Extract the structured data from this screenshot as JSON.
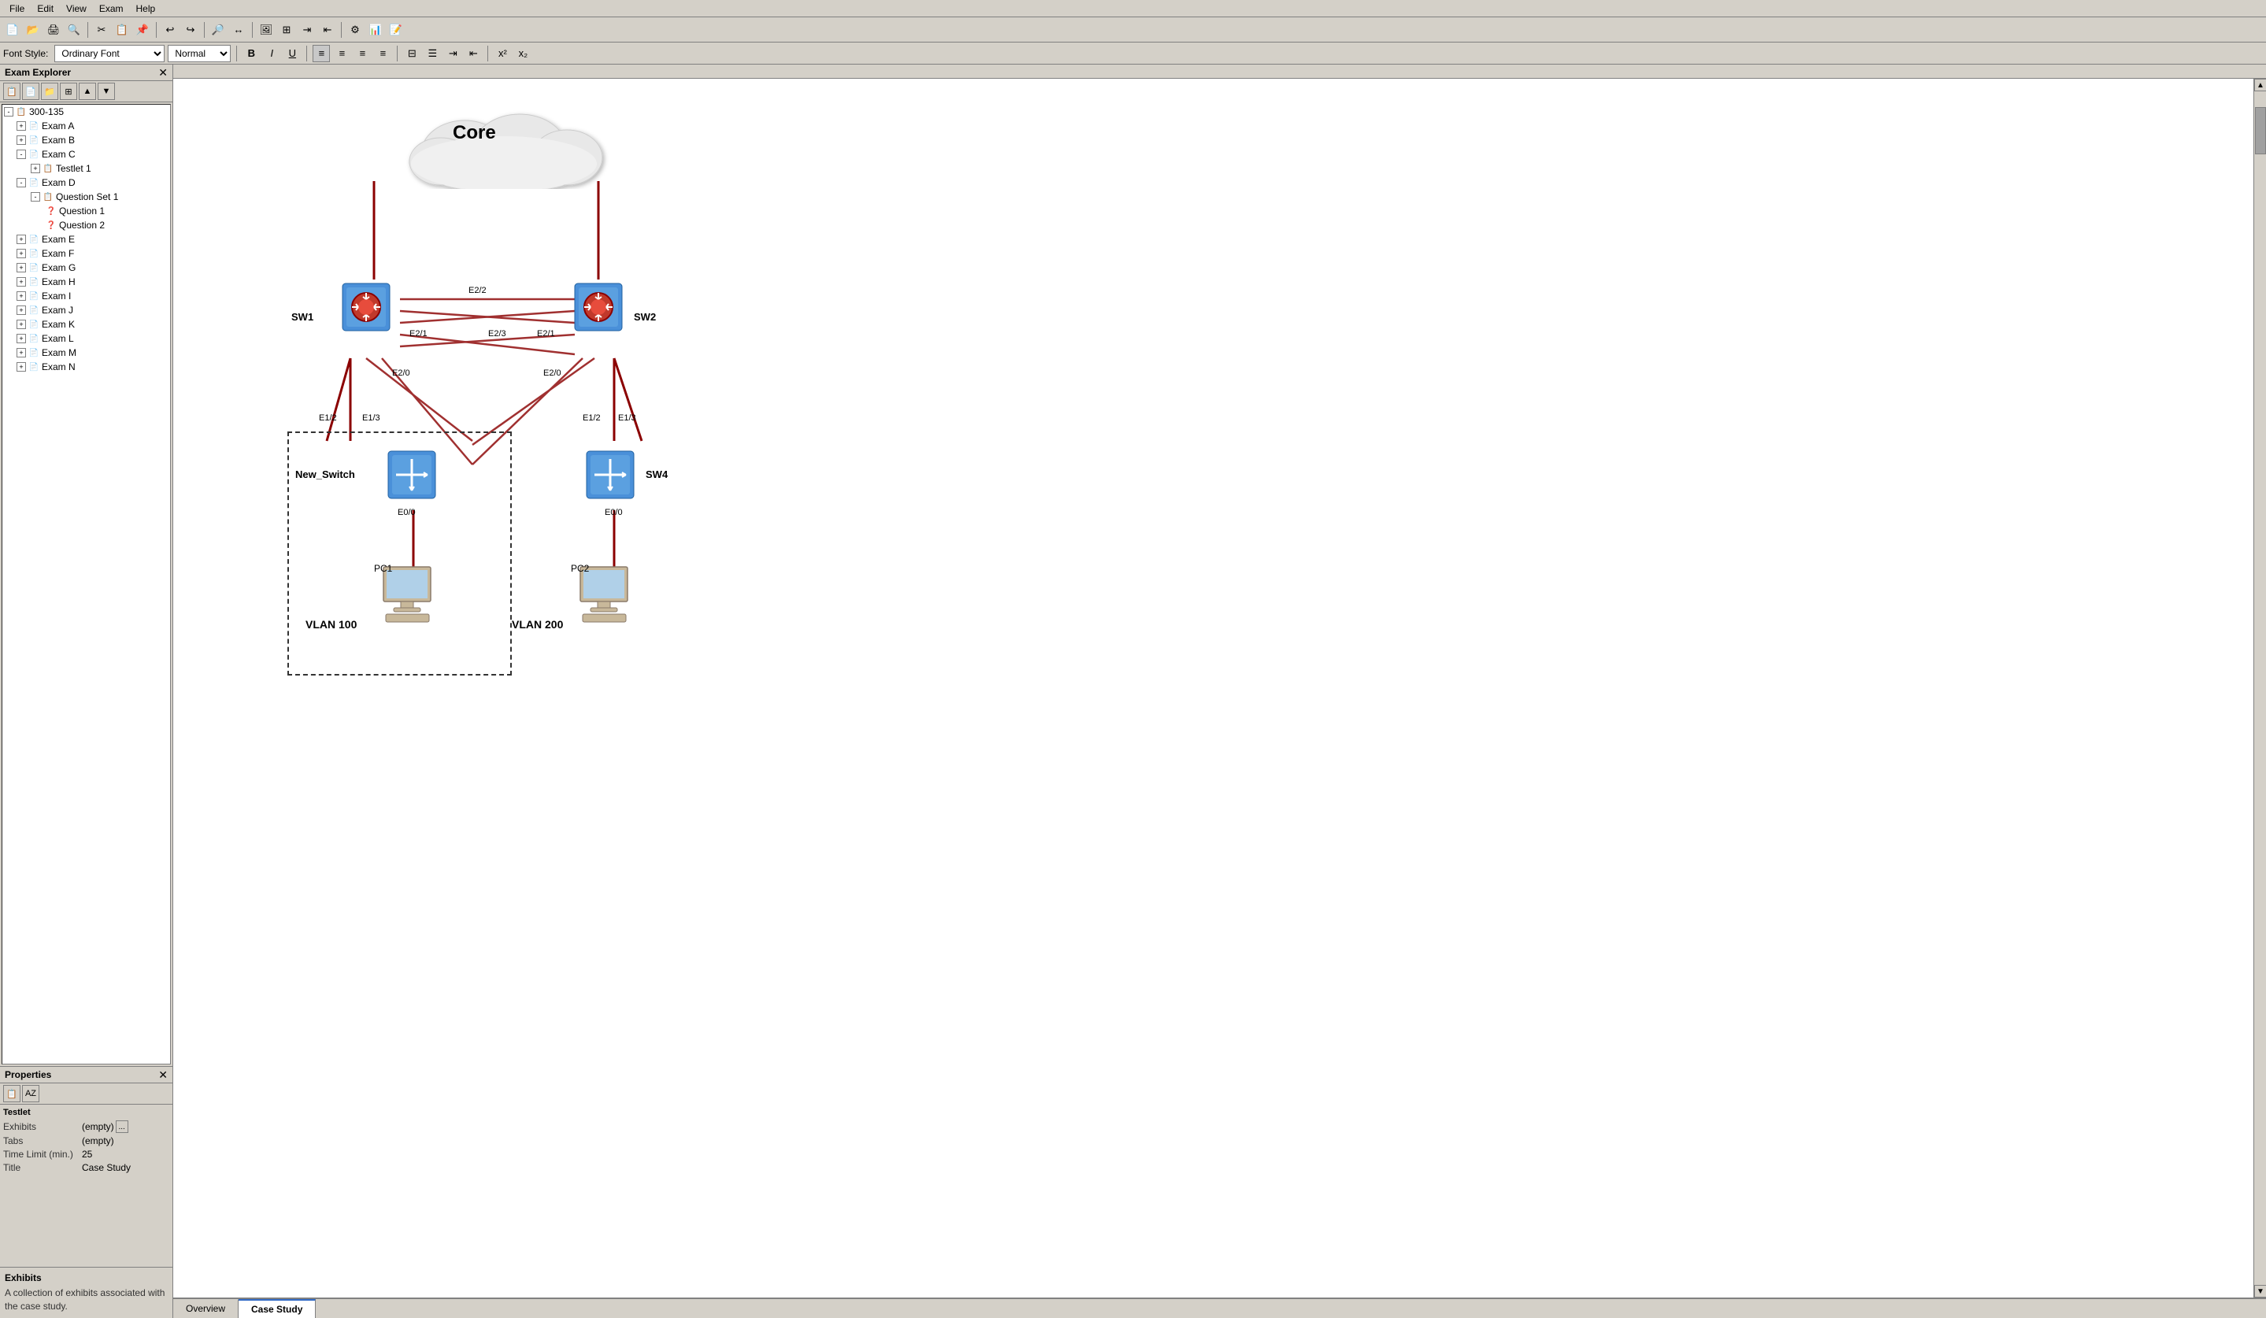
{
  "app": {
    "menu": [
      "File",
      "Edit",
      "View",
      "Exam",
      "Help"
    ],
    "font_style_label": "Font Style:",
    "font_name": "Ordinary Font",
    "font_size": "Normal",
    "bold": "B",
    "italic": "I",
    "underline": "U"
  },
  "explorer": {
    "title": "Exam Explorer",
    "root": "300-135",
    "items": [
      {
        "id": "exam-a",
        "label": "Exam A",
        "level": 1,
        "expanded": false
      },
      {
        "id": "exam-b",
        "label": "Exam B",
        "level": 1,
        "expanded": false
      },
      {
        "id": "exam-c",
        "label": "Exam C",
        "level": 1,
        "expanded": true
      },
      {
        "id": "testlet-1",
        "label": "Testlet 1",
        "level": 2,
        "expanded": false
      },
      {
        "id": "exam-d",
        "label": "Exam D",
        "level": 1,
        "expanded": true
      },
      {
        "id": "question-set-1",
        "label": "Question Set 1",
        "level": 2,
        "expanded": true
      },
      {
        "id": "question-1",
        "label": "Question 1",
        "level": 3,
        "expanded": false
      },
      {
        "id": "question-2",
        "label": "Question 2",
        "level": 3,
        "expanded": false
      },
      {
        "id": "exam-e",
        "label": "Exam E",
        "level": 1,
        "expanded": false
      },
      {
        "id": "exam-f",
        "label": "Exam F",
        "level": 1,
        "expanded": false
      },
      {
        "id": "exam-g",
        "label": "Exam G",
        "level": 1,
        "expanded": false
      },
      {
        "id": "exam-h",
        "label": "Exam H",
        "level": 1,
        "expanded": false
      },
      {
        "id": "exam-i",
        "label": "Exam I",
        "level": 1,
        "expanded": false
      },
      {
        "id": "exam-j",
        "label": "Exam J",
        "level": 1,
        "expanded": false
      },
      {
        "id": "exam-k",
        "label": "Exam K",
        "level": 1,
        "expanded": false
      },
      {
        "id": "exam-l",
        "label": "Exam L",
        "level": 1,
        "expanded": false
      },
      {
        "id": "exam-m",
        "label": "Exam M",
        "level": 1,
        "expanded": false
      },
      {
        "id": "exam-n",
        "label": "Exam N",
        "level": 1,
        "expanded": false
      }
    ]
  },
  "properties": {
    "title": "Properties",
    "section": "Testlet",
    "fields": [
      {
        "label": "Exhibits",
        "value": "(empty)",
        "has_btn": true
      },
      {
        "label": "Tabs",
        "value": "(empty)",
        "has_btn": false
      },
      {
        "label": "Time Limit (min.)",
        "value": "25",
        "has_btn": false
      },
      {
        "label": "Title",
        "value": "Case Study",
        "has_btn": false
      }
    ]
  },
  "bottom_desc": {
    "title": "Exhibits",
    "text": "A collection of exhibits associated with the case study."
  },
  "tabs": [
    {
      "label": "Overview",
      "active": false
    },
    {
      "label": "Case Study",
      "active": true
    }
  ],
  "diagram": {
    "core_label": "Core",
    "sw1_label": "SW1",
    "sw2_label": "SW2",
    "sw4_label": "SW4",
    "new_switch_label": "New_Switch",
    "pc1_label": "PC1",
    "pc2_label": "PC2",
    "vlan100_label": "VLAN 100",
    "vlan200_label": "VLAN 200",
    "ports": {
      "sw1_e2_2": "E2/2",
      "sw1_e2_1": "E2/1",
      "sw1_e2_0": "E2/0",
      "sw1_e1_2": "E1/2",
      "sw1_e1_3": "E1/3",
      "sw2_e2_3": "E2/3",
      "sw2_e2_1": "E2/1",
      "sw2_e2_0": "E2/0",
      "sw2_e1_2": "E1/2",
      "sw2_e1_3": "E1/3",
      "ns_e0_0": "E0/0",
      "sw4_e0_0": "E0/0"
    }
  }
}
